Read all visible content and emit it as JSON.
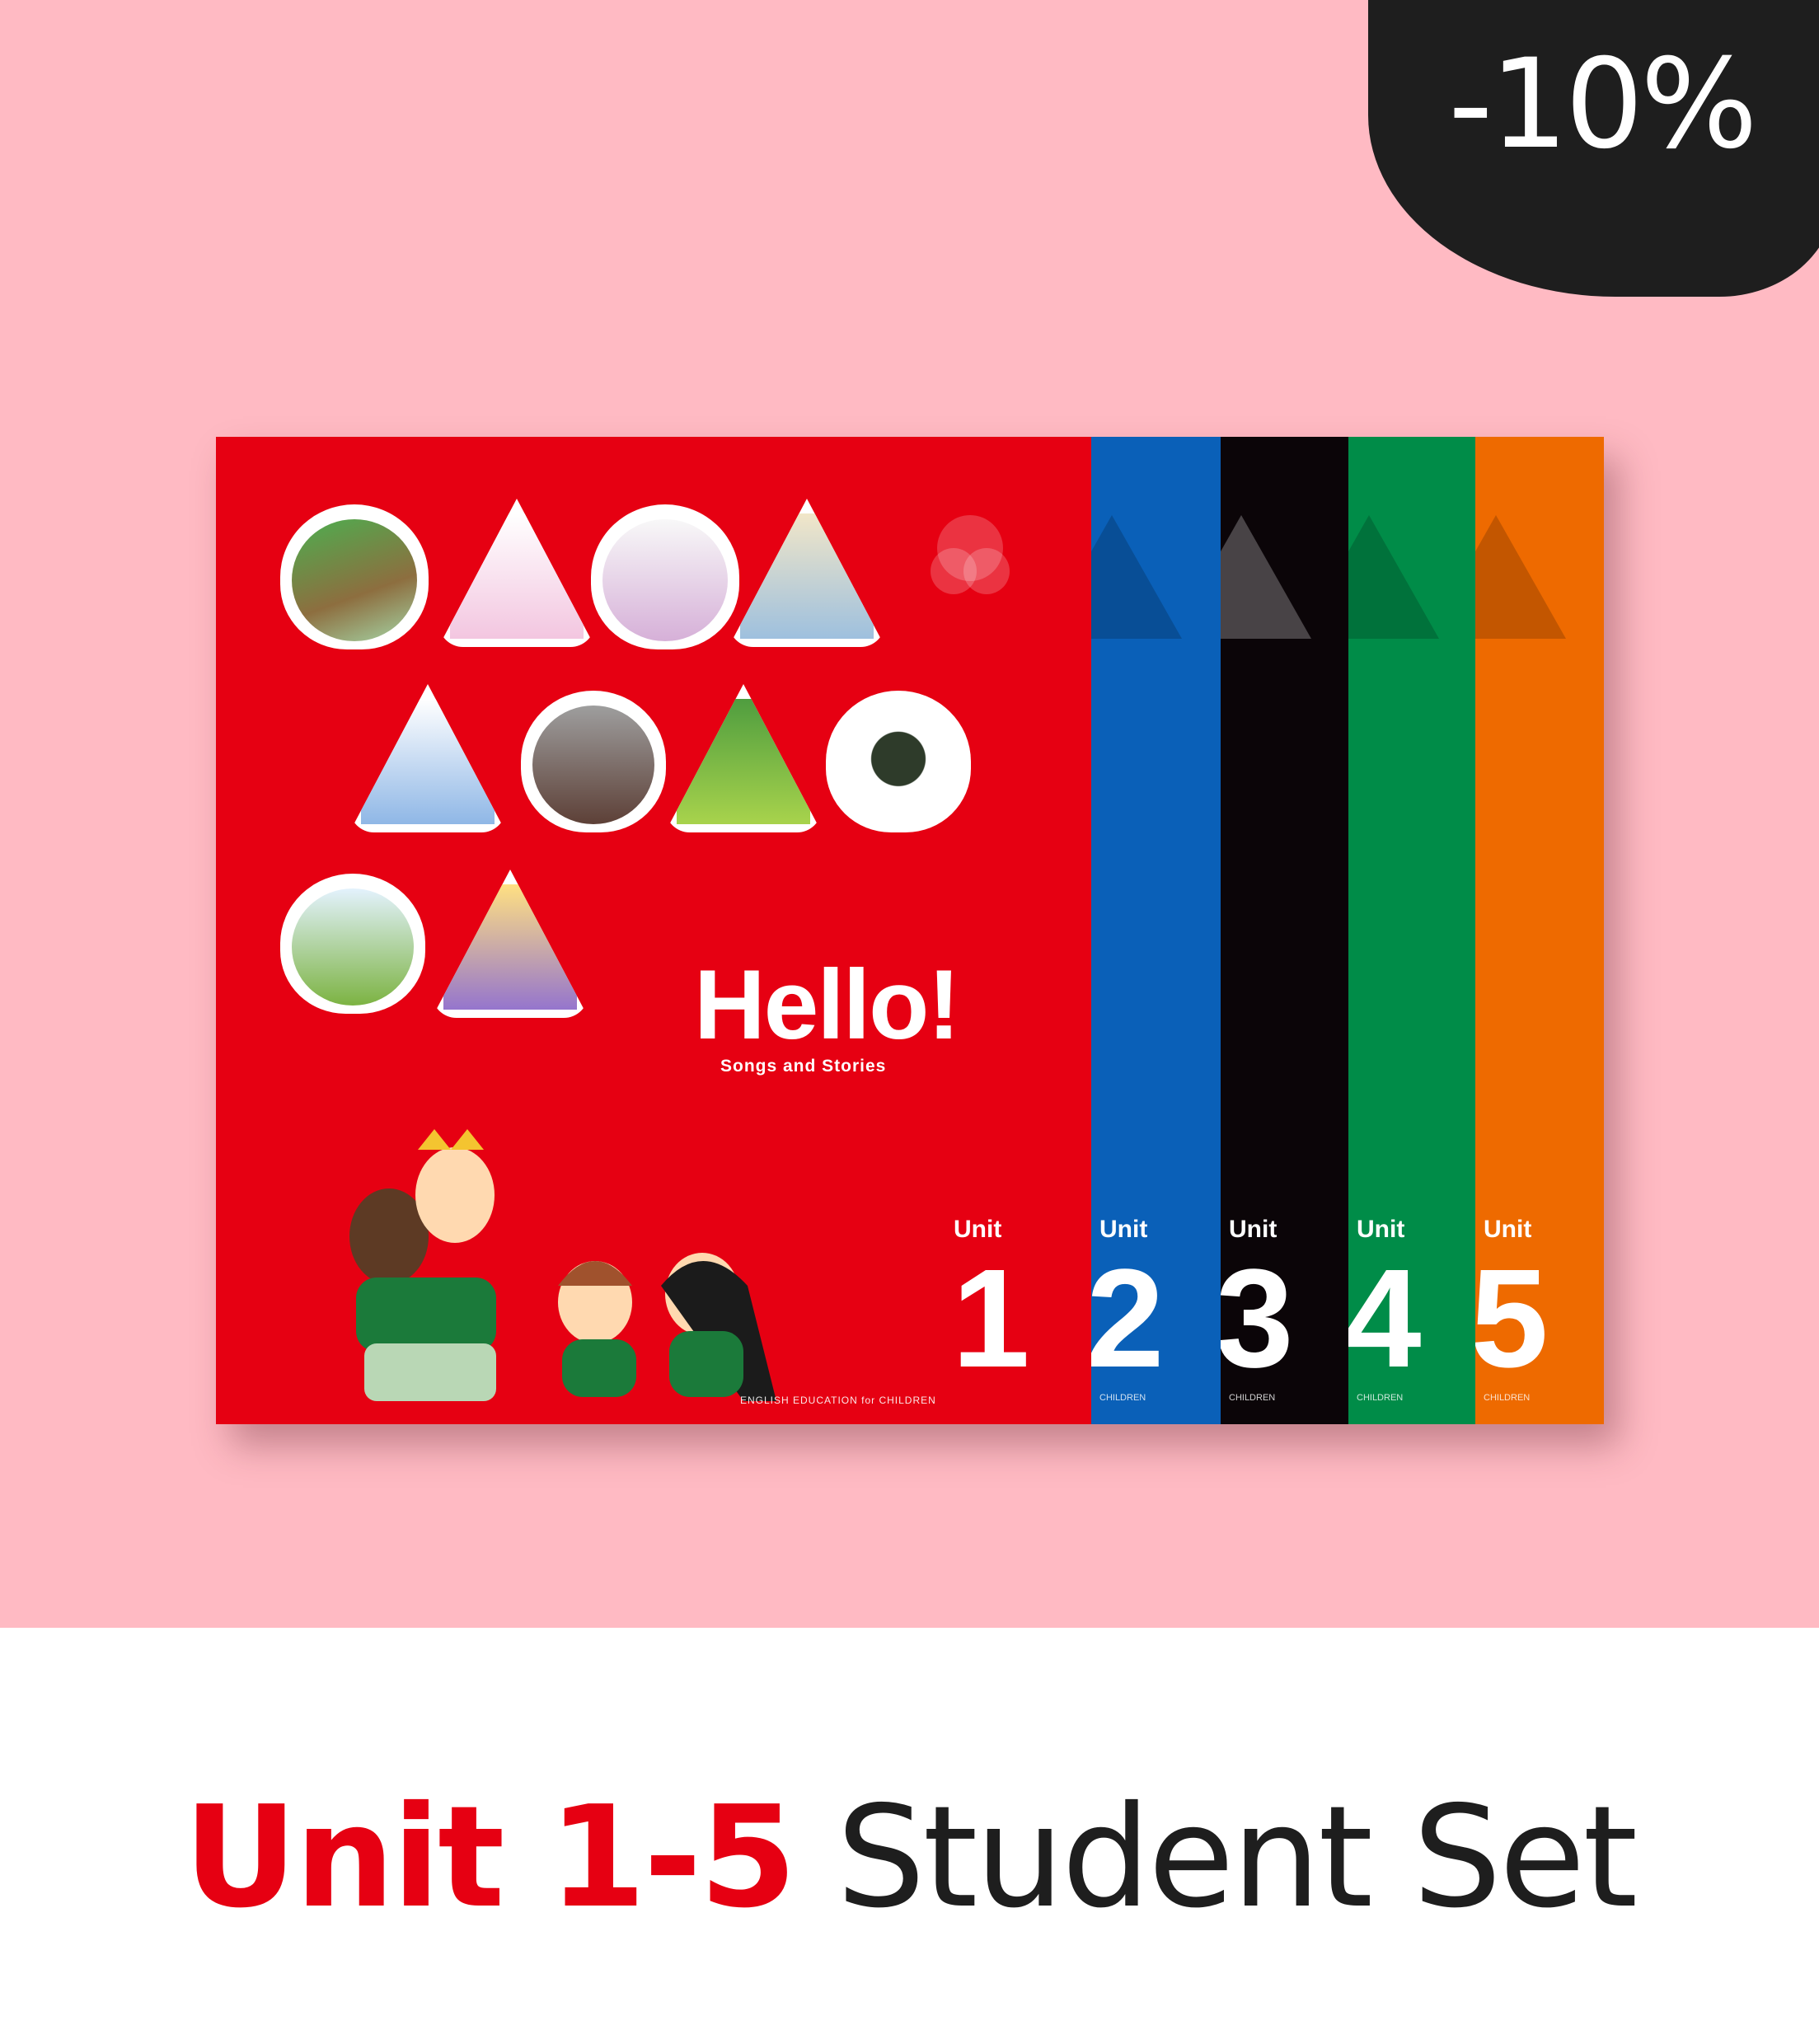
{
  "badge": {
    "discount": "-10%"
  },
  "cover": {
    "title": "Hello!",
    "subtitle": "Songs and Stories",
    "unit_label": "Unit",
    "unit_number": "1",
    "footer": "ENGLISH EDUCATION for CHILDREN"
  },
  "spines": [
    {
      "unit_label": "Unit",
      "unit_number": "2",
      "color": "#0a60b8",
      "footer": "CHILDREN"
    },
    {
      "unit_label": "Unit",
      "unit_number": "3",
      "color": "#0b0508",
      "footer": "CHILDREN"
    },
    {
      "unit_label": "Unit",
      "unit_number": "4",
      "color": "#008c48",
      "footer": "CHILDREN"
    },
    {
      "unit_label": "Unit",
      "unit_number": "5",
      "color": "#ee6a00",
      "footer": "CHILDREN"
    }
  ],
  "caption": {
    "highlight": "Unit 1-5",
    "rest": "Student Set"
  },
  "colors": {
    "background": "#ffbac3",
    "cover_red": "#e60012",
    "badge": "#1e1e1e"
  }
}
